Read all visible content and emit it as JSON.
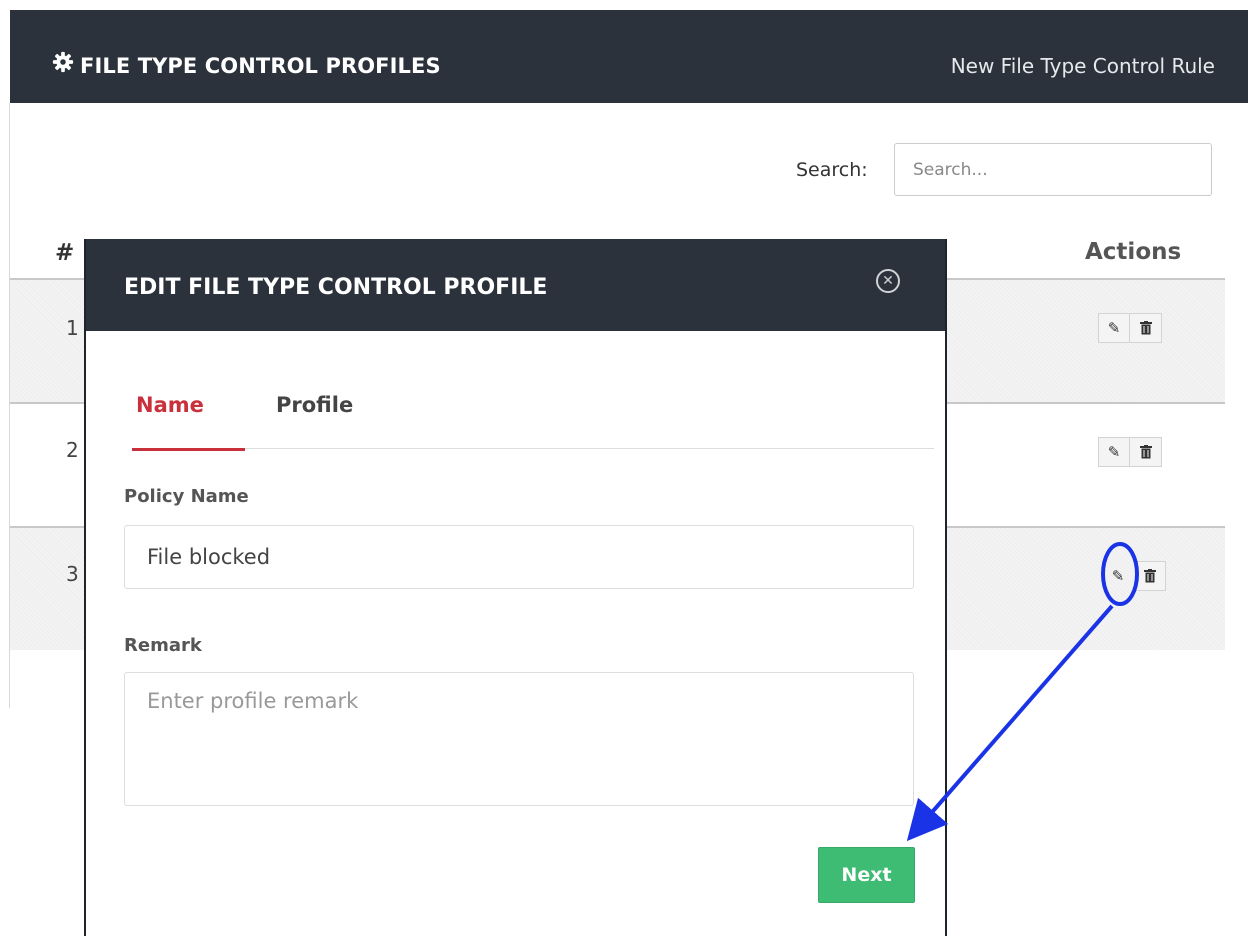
{
  "header": {
    "title": "FILE TYPE CONTROL PROFILES",
    "new_rule_label": "New File Type Control Rule",
    "title_icon": "gear-icon"
  },
  "search": {
    "label": "Search:",
    "placeholder": "Search..."
  },
  "table": {
    "columns": [
      "#",
      "Actions"
    ],
    "rows": [
      {
        "num": "1"
      },
      {
        "num": "2"
      },
      {
        "num": "3"
      }
    ],
    "edit_icon": "pencil-icon",
    "delete_icon": "trash-icon"
  },
  "modal": {
    "title": "EDIT FILE TYPE CONTROL PROFILE",
    "close_icon": "close-circle-icon",
    "tabs": [
      {
        "label": "Name",
        "active": true
      },
      {
        "label": "Profile",
        "active": false
      }
    ],
    "policy_name_label": "Policy Name",
    "policy_name_value": "File blocked",
    "remark_label": "Remark",
    "remark_placeholder": "Enter profile remark",
    "next_label": "Next"
  },
  "colors": {
    "header_bg": "#2b323b",
    "active_tab": "#c9303c",
    "next_button": "#3ebc74",
    "annotation": "#1a33e6"
  }
}
